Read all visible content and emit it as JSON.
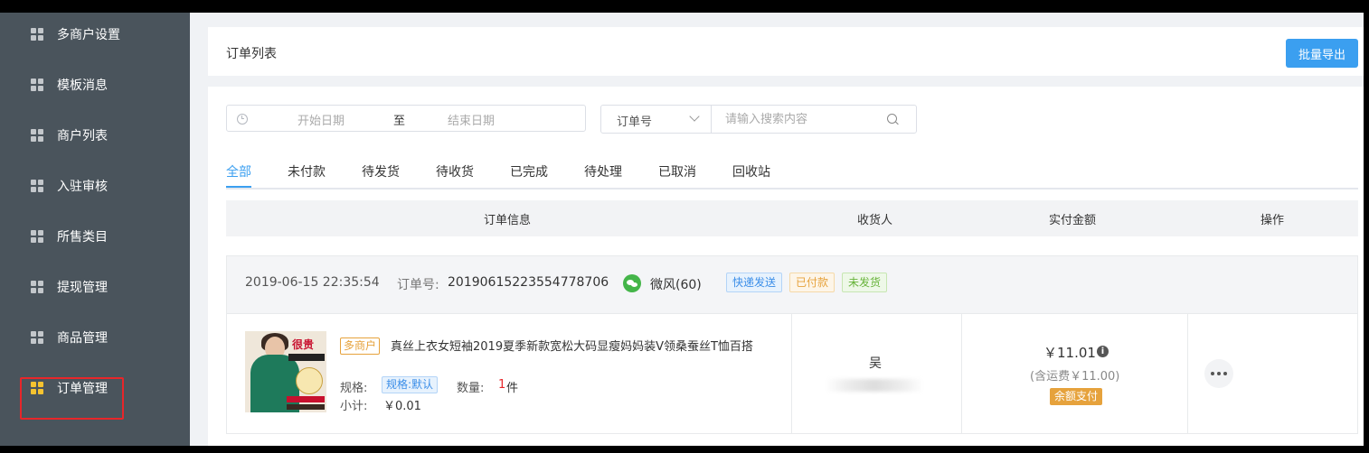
{
  "sidebar": {
    "items": [
      {
        "label": "多商户设置",
        "icon": "grid-icon"
      },
      {
        "label": "模板消息",
        "icon": "grid-icon"
      },
      {
        "label": "商户列表",
        "icon": "grid-icon"
      },
      {
        "label": "入驻审核",
        "icon": "grid-icon"
      },
      {
        "label": "所售类目",
        "icon": "grid-icon"
      },
      {
        "label": "提现管理",
        "icon": "grid-icon"
      },
      {
        "label": "商品管理",
        "icon": "grid-icon"
      },
      {
        "label": "订单管理",
        "icon": "grid-icon",
        "active": true
      }
    ],
    "active_color": "#f5c330",
    "highlight_box_color": "#e8262a"
  },
  "header": {
    "title": "订单列表",
    "export_label": "批量导出"
  },
  "filters": {
    "start_placeholder": "开始日期",
    "separator": "至",
    "end_placeholder": "结束日期",
    "search_type": "订单号",
    "search_placeholder": "请输入搜索内容"
  },
  "tabs": [
    {
      "label": "全部",
      "active": true
    },
    {
      "label": "未付款"
    },
    {
      "label": "待发货"
    },
    {
      "label": "待收货"
    },
    {
      "label": "已完成"
    },
    {
      "label": "待处理"
    },
    {
      "label": "已取消"
    },
    {
      "label": "回收站"
    }
  ],
  "table": {
    "columns": [
      "订单信息",
      "收货人",
      "实付金额",
      "操作"
    ]
  },
  "order": {
    "time": "2019-06-15 22:35:54",
    "order_no_label": "订单号:",
    "order_no": "20190615223554778706",
    "user": "微风(60)",
    "tags": [
      "快递发送",
      "已付款",
      "未发货"
    ],
    "product": {
      "merchant_tag": "多商户",
      "title": "真丝上衣女短袖2019夏季新款宽松大码显瘦妈妈装V领桑蚕丝T恤百搭",
      "image_badge": "很贵",
      "spec_label": "规格:",
      "spec_value": "规格:默认",
      "qty_label": "数量:",
      "qty_value": "1",
      "qty_unit": "件",
      "subtotal_label": "小计:",
      "subtotal_value": "￥0.01"
    },
    "receiver": "吴",
    "amount": "￥11.01",
    "info_icon": "i",
    "freight": "(含运费￥11.00)",
    "pay_method": "余额支付"
  }
}
